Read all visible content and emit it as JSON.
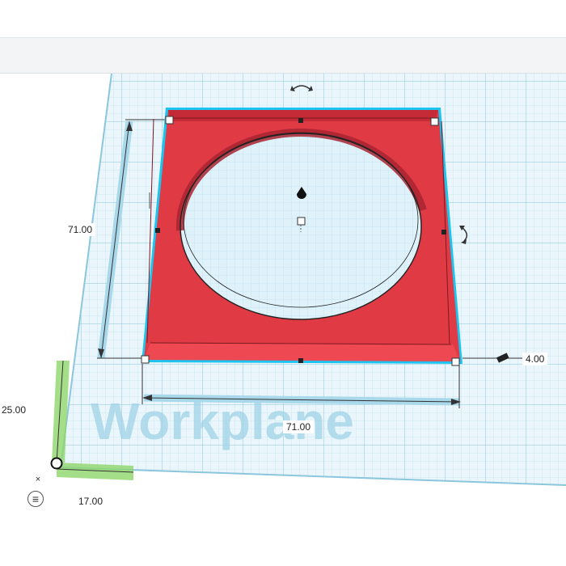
{
  "workplane": {
    "label": "Workplane",
    "grid_color": "#9ccfe3",
    "fill_color": "#eaf6fb"
  },
  "shape": {
    "color": "#e03a45",
    "outline_color": "#1ec4f0"
  },
  "dimensions": {
    "height_left": "71.00",
    "width_bottom": "71.00",
    "elevation_right": "4.00",
    "origin_y": "25.00",
    "origin_x": "17.00"
  },
  "controls": {
    "close_icon": "×",
    "menu_icon": "≡"
  }
}
